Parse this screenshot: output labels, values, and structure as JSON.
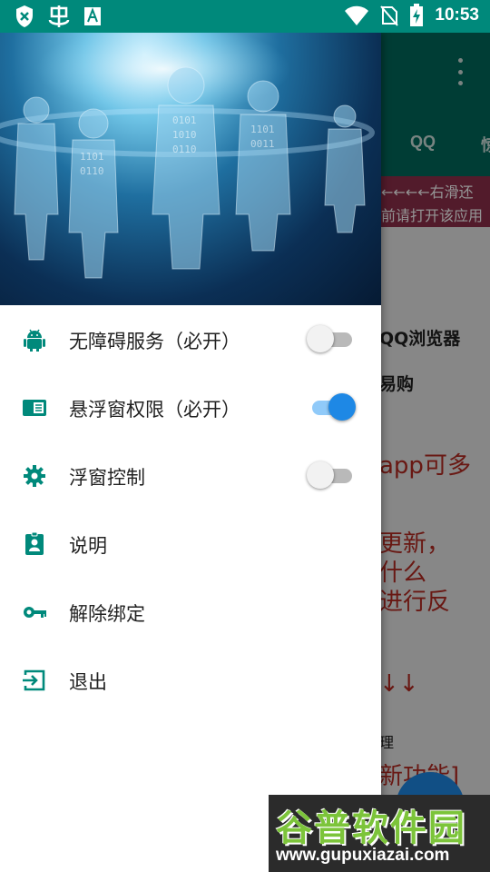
{
  "status_bar": {
    "time": "10:53",
    "left_icons": [
      "shield-x-icon",
      "bug-icon",
      "text-badge-icon"
    ],
    "right_icons": [
      "wifi-icon",
      "no-sim-icon",
      "battery-charging-icon"
    ]
  },
  "background_app": {
    "tabs": [
      "QQ",
      "惊"
    ],
    "banner_lines": [
      "←←←←右滑还",
      "前请打开该应用"
    ],
    "body_lines": [
      {
        "text": "QQ浏览器",
        "style": "dark",
        "top": 0
      },
      {
        "text": "易购",
        "style": "dark"
      },
      {
        "text": "app可多",
        "style": "red"
      },
      {
        "text": "更新，",
        "style": "red"
      },
      {
        "text": "什么",
        "style": "red"
      },
      {
        "text": "进行反",
        "style": "red"
      },
      {
        "text": "↓↓",
        "style": "red"
      },
      {
        "text": "理",
        "style": "small"
      },
      {
        "text": "新功能]",
        "style": "red"
      }
    ]
  },
  "drawer": {
    "menu_items": [
      {
        "label": "无障碍服务（必开）",
        "icon": "android-icon",
        "toggle": false
      },
      {
        "label": "悬浮窗权限（必开）",
        "icon": "window-icon",
        "toggle": true
      },
      {
        "label": "浮窗控制",
        "icon": "gear-icon",
        "toggle": false
      },
      {
        "label": "说明",
        "icon": "badge-icon"
      },
      {
        "label": "解除绑定",
        "icon": "key-icon"
      },
      {
        "label": "退出",
        "icon": "exit-icon"
      }
    ]
  },
  "watermark": {
    "title": "谷普软件园",
    "url": "www.gupuxiazai.com"
  },
  "colors": {
    "status_bar": "#00897b",
    "toolbar": "#00695c",
    "accent": "#1e88e5",
    "icon_teal": "#00897b",
    "banner": "#8d2f4a",
    "red_text": "#b52a22"
  }
}
